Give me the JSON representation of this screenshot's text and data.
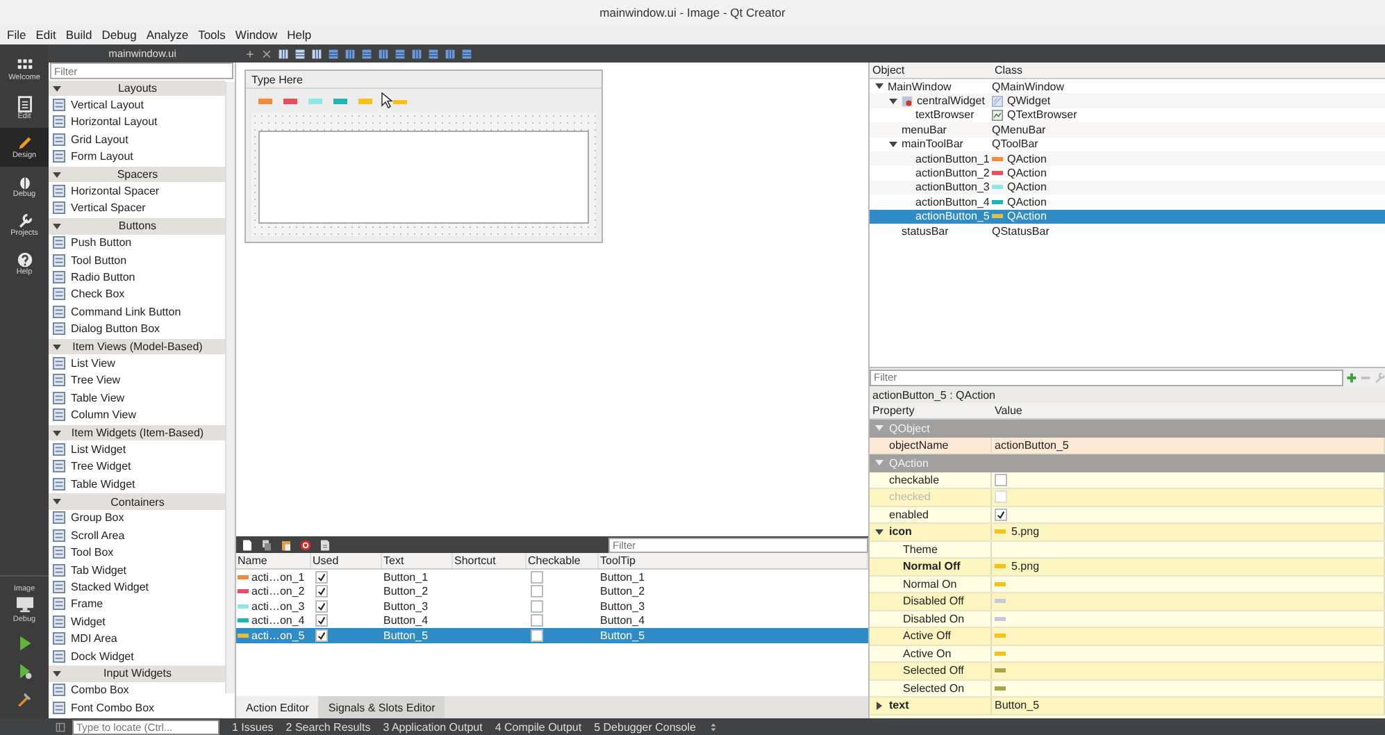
{
  "window": {
    "title": "mainwindow.ui - Image - Qt Creator"
  },
  "menu": [
    "File",
    "Edit",
    "Build",
    "Debug",
    "Analyze",
    "Tools",
    "Window",
    "Help"
  ],
  "modes": [
    {
      "label": "Welcome",
      "kind": "welcome",
      "selected": false
    },
    {
      "label": "Edit",
      "kind": "edit",
      "selected": false
    },
    {
      "label": "Design",
      "kind": "design",
      "selected": true
    },
    {
      "label": "Debug",
      "kind": "debug",
      "selected": false
    },
    {
      "label": "Projects",
      "kind": "projects",
      "selected": false
    },
    {
      "label": "Help",
      "kind": "help",
      "selected": false
    }
  ],
  "kit": {
    "project": "Image",
    "config": "Debug"
  },
  "document": "mainwindow.ui",
  "widget_box": {
    "filter_placeholder": "Filter",
    "categories": [
      {
        "name": "Layouts",
        "expanded": true,
        "items": [
          "Vertical Layout",
          "Horizontal Layout",
          "Grid Layout",
          "Form Layout"
        ]
      },
      {
        "name": "Spacers",
        "expanded": true,
        "items": [
          "Horizontal Spacer",
          "Vertical Spacer"
        ]
      },
      {
        "name": "Buttons",
        "expanded": true,
        "items": [
          "Push Button",
          "Tool Button",
          "Radio Button",
          "Check Box",
          "Command Link Button",
          "Dialog Button Box"
        ]
      },
      {
        "name": "Item Views (Model-Based)",
        "expanded": true,
        "items": [
          "List View",
          "Tree View",
          "Table View",
          "Column View"
        ]
      },
      {
        "name": "Item Widgets (Item-Based)",
        "expanded": true,
        "items": [
          "List Widget",
          "Tree Widget",
          "Table Widget"
        ]
      },
      {
        "name": "Containers",
        "expanded": true,
        "items": [
          "Group Box",
          "Scroll Area",
          "Tool Box",
          "Tab Widget",
          "Stacked Widget",
          "Frame",
          "Widget",
          "MDI Area",
          "Dock Widget"
        ]
      },
      {
        "name": "Input Widgets",
        "expanded": true,
        "items": [
          "Combo Box",
          "Font Combo Box"
        ]
      }
    ]
  },
  "form": {
    "menu_placeholder": "Type Here",
    "toolbar_actions": [
      {
        "color": "#f28a3c"
      },
      {
        "color": "#ee4d5f"
      },
      {
        "color": "#8ee6e6"
      },
      {
        "color": "#1fb5b5"
      },
      {
        "color": "#f5c21b"
      }
    ],
    "drag": {
      "color": "#f5c21b"
    }
  },
  "action_editor": {
    "filter_placeholder": "Filter",
    "columns": [
      "Name",
      "Used",
      "Text",
      "Shortcut",
      "Checkable",
      "ToolTip"
    ],
    "rows": [
      {
        "name": "acti…on_1",
        "color": "#f28a3c",
        "used": true,
        "text": "Button_1",
        "checkable": false,
        "tooltip": "Button_1",
        "selected": false
      },
      {
        "name": "acti…on_2",
        "color": "#ee4d5f",
        "used": true,
        "text": "Button_2",
        "checkable": false,
        "tooltip": "Button_2",
        "selected": false
      },
      {
        "name": "acti…on_3",
        "color": "#8ee6e6",
        "used": true,
        "text": "Button_3",
        "checkable": false,
        "tooltip": "Button_3",
        "selected": false
      },
      {
        "name": "acti…on_4",
        "color": "#1fb5b5",
        "used": true,
        "text": "Button_4",
        "checkable": false,
        "tooltip": "Button_4",
        "selected": false
      },
      {
        "name": "acti…on_5",
        "color": "#d9c24a",
        "used": true,
        "text": "Button_5",
        "checkable": false,
        "tooltip": "Button_5",
        "selected": true
      }
    ],
    "tabs": [
      {
        "label": "Action Editor",
        "selected": true
      },
      {
        "label": "Signals & Slots Editor",
        "selected": false
      }
    ]
  },
  "object_inspector": {
    "columns": [
      "Object",
      "Class"
    ],
    "filter_placeholder": "Filter",
    "tree": [
      {
        "object": "MainWindow",
        "class": "QMainWindow",
        "expanded": true,
        "selected": false,
        "children": [
          {
            "object": "centralWidget",
            "class": "QWidget",
            "kind": "widget",
            "expanded": true,
            "selected": false,
            "children": [
              {
                "object": "textBrowser",
                "class": "QTextBrowser",
                "kind": "browser",
                "selected": false
              }
            ]
          },
          {
            "object": "menuBar",
            "class": "QMenuBar",
            "selected": false
          },
          {
            "object": "mainToolBar",
            "class": "QToolBar",
            "expanded": true,
            "selected": false,
            "children": [
              {
                "object": "actionButton_1",
                "class": "QAction",
                "kind": "action",
                "color": "#f28a3c",
                "selected": false
              },
              {
                "object": "actionButton_2",
                "class": "QAction",
                "kind": "action",
                "color": "#ee4d5f",
                "selected": false
              },
              {
                "object": "actionButton_3",
                "class": "QAction",
                "kind": "action",
                "color": "#8ee6e6",
                "selected": false
              },
              {
                "object": "actionButton_4",
                "class": "QAction",
                "kind": "action",
                "color": "#1fb5b5",
                "selected": false
              },
              {
                "object": "actionButton_5",
                "class": "QAction",
                "kind": "action",
                "color": "#d9c24a",
                "selected": true
              }
            ]
          },
          {
            "object": "statusBar",
            "class": "QStatusBar",
            "selected": false
          }
        ]
      }
    ]
  },
  "property_editor": {
    "caption": "actionButton_5 : QAction",
    "columns": [
      "Property",
      "Value"
    ],
    "groups": [
      {
        "name": "QObject",
        "expanded": true,
        "children": [
          {
            "kind": "text",
            "name": "objectName",
            "value": "actionButton_5",
            "modified": false
          }
        ]
      },
      {
        "name": "QAction",
        "expanded": true,
        "children": [
          {
            "kind": "bool",
            "name": "checkable",
            "checked": false,
            "disabled": false
          },
          {
            "kind": "bool",
            "name": "checked",
            "checked": false,
            "disabled": true
          },
          {
            "kind": "bool",
            "name": "enabled",
            "checked": true,
            "disabled": false
          },
          {
            "kind": "icon",
            "name": "icon",
            "value": "5.png",
            "color": "#f5c21b",
            "modified": true,
            "expanded": true,
            "children": [
              {
                "kind": "icon",
                "name": "Theme",
                "modified": false
              },
              {
                "kind": "icon",
                "name": "Normal Off",
                "value": "5.png",
                "color": "#f5c21b",
                "modified": true
              },
              {
                "kind": "icon",
                "name": "Normal On",
                "color": "#f5c21b",
                "modified": false
              },
              {
                "kind": "icon",
                "name": "Disabled Off",
                "color": "#c9c9dc",
                "modified": false
              },
              {
                "kind": "icon",
                "name": "Disabled On",
                "color": "#c9c9dc",
                "modified": false
              },
              {
                "kind": "icon",
                "name": "Active Off",
                "color": "#f5c21b",
                "modified": false
              },
              {
                "kind": "icon",
                "name": "Active On",
                "color": "#f5c21b",
                "modified": false
              },
              {
                "kind": "icon",
                "name": "Selected Off",
                "color": "#a6a64a",
                "modified": false
              },
              {
                "kind": "icon",
                "name": "Selected On",
                "color": "#a6a64a",
                "modified": false
              }
            ]
          },
          {
            "kind": "text",
            "name": "text",
            "value": "Button_5",
            "modified": true,
            "expanded": false
          }
        ]
      }
    ]
  },
  "status_bar": {
    "locator_placeholder": "Type to locate (Ctrl...",
    "panes": [
      "1 Issues",
      "2 Search Results",
      "3 Application Output",
      "4 Compile Output",
      "5 Debugger Console"
    ]
  }
}
